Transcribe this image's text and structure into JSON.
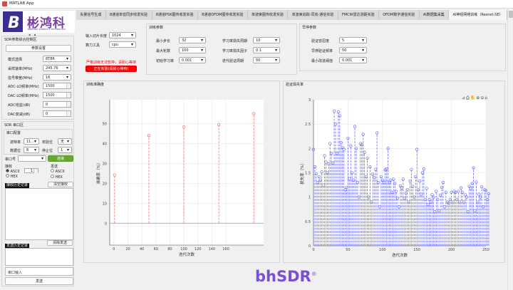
{
  "window": {
    "title": "MATLAB App"
  },
  "logo": {
    "company_cn": "彬鸿科技",
    "company_en": "BINHONG SCIENCE & TECHNOLOGY",
    "brand": "bhSDR",
    "registered": "®"
  },
  "sdr_params": {
    "title": "SDR参数综合控制区",
    "set_button": "参数设置",
    "rows": [
      {
        "label": "模式选择",
        "value": "8T8R",
        "type": "select"
      },
      {
        "label": "采样速率(MHz)",
        "value": "245.76",
        "type": "select"
      },
      {
        "label": "信号带宽(MHz)",
        "value": "16",
        "type": "select"
      },
      {
        "label": "ADC-LO频率(MHz)",
        "value": "1500",
        "type": "spin"
      },
      {
        "label": "DAC-LO频率(MHz)",
        "value": "1500",
        "type": "spin"
      },
      {
        "label": "ADC增益(dB)",
        "value": "0",
        "type": "spin"
      },
      {
        "label": "DAC衰减(dB)",
        "value": "0",
        "type": "spin"
      }
    ]
  },
  "serial": {
    "title": "SDR 串口区",
    "config_title": "串口配置",
    "baud_label": "波特率",
    "baud": "11...",
    "parity_label": "校验位",
    "parity": "无",
    "databits_label": "数据位",
    "databits": "8",
    "stopbits_label": "停止位",
    "stopbits": "1",
    "port_label": "串口号",
    "port": "",
    "connect": "连接",
    "recv_label": "接收",
    "send_label": "发送",
    "ascii": "ASCII",
    "hex": "HEX",
    "recv_spin": "1",
    "recv_history": "接收历史记录",
    "clear_recv": "清空接收",
    "send_history": "发送历史记录",
    "clear_send": "清除发送",
    "input_placeholder": "串口输入",
    "send_button": "发送"
  },
  "tabs": [
    {
      "label": "矢量信号生成",
      "active": false
    },
    {
      "label": "8通道单音同步收发实验",
      "active": false
    },
    {
      "label": "8通道PSK图传收发实验",
      "active": false
    },
    {
      "label": "8通道OFDM图传收发实验",
      "active": false
    },
    {
      "label": "单波束图传收发实验",
      "active": false
    },
    {
      "label": "单波束追踪-同向-通信实验",
      "active": false
    },
    {
      "label": "FMCW雷达测距实验",
      "active": false
    },
    {
      "label": "OFDM数字通信实验",
      "active": false
    },
    {
      "label": "AI数据集采集",
      "active": false
    },
    {
      "label": "AI神经网络训练（Resnet-SE）",
      "active": true
    }
  ],
  "main": {
    "slice_len_label": "输入切片长度",
    "slice_len": "1024",
    "compute_label": "算力工具",
    "compute": "cpu",
    "warning": "严格训练无法暂停，请耐心等待",
    "running_button": "正在实验(请耐心等待)",
    "train": {
      "title": "训练参数",
      "min_batch_label": "最小步长",
      "min_batch": "32",
      "max_epoch_label": "最大轮数",
      "max_epoch": "100",
      "init_lr_label": "初始学习率",
      "init_lr": "0.001",
      "lr_period_label": "学习率损失周期",
      "lr_period": "10",
      "lr_factor_label": "学习率损失因子",
      "lr_factor": "0.1",
      "val_freq_label": "迭代验证周期",
      "val_freq": "50"
    },
    "early": {
      "title": "早停参数",
      "patience_label": "验证容忍度",
      "patience": "5",
      "freq_label": "早停验证频率",
      "freq": "50",
      "min_delta_label": "最小改进阈值",
      "min_delta": "0.001"
    }
  },
  "chart_data": [
    {
      "type": "stem",
      "title": "训练准确度",
      "xlabel": "迭代次数",
      "ylabel": "准确率（%）",
      "color": "#ff7070",
      "xlim": [
        -6,
        214
      ],
      "ylim": [
        -11,
        62
      ],
      "xticks": [
        0,
        20,
        40,
        60,
        80,
        100,
        120,
        140,
        160
      ],
      "yticks": [
        0,
        10,
        20,
        30,
        40,
        50
      ],
      "grid": true,
      "x": [
        1,
        50,
        100,
        150,
        200
      ],
      "y": [
        24.2,
        44,
        48.3,
        49.5,
        55
      ]
    },
    {
      "type": "stem",
      "title": "验证损失率",
      "xlabel": "迭代次数",
      "ylabel": "损失率（%）",
      "color": "#6b6bff",
      "xlim": [
        0,
        250
      ],
      "ylim": [
        0,
        3
      ],
      "xticks": [
        0,
        50,
        100,
        150,
        200,
        250
      ],
      "yticks": [
        0,
        0.5,
        1,
        1.5,
        2,
        2.5,
        3
      ],
      "grid": true,
      "x_start": 0,
      "x_step": 2,
      "y": [
        1.98,
        1.62,
        1.48,
        1.3,
        1.42,
        1.35,
        1.52,
        1.25,
        1.85,
        1.72,
        1.5,
        1.68,
        2.1,
        1.9,
        1.7,
        2.77,
        2.5,
        1.9,
        2.75,
        2.67,
        2.12,
        2.02,
        1.98,
        1.15,
        1.2,
        2.21,
        1.38,
        2.05,
        1.5,
        1.35,
        2.45,
        2.0,
        1.3,
        1.0,
        2.1,
        2.08,
        2.29,
        1.92,
        1.42,
        1.8,
        1.0,
        1.62,
        0.9,
        1.47,
        1.4,
        1.57,
        2.32,
        1.3,
        0.8,
        1.42,
        1.35,
        1.3,
        1.56,
        1.58,
        2.0,
        1.3,
        1.35,
        1.1,
        1.37,
        1.28,
        1.12,
        0.98,
        0.8,
        1.23,
        1.19,
        1.37,
        0.98,
        1.08,
        1.15,
        0.9,
        1.33,
        1.57,
        1.22,
        1.0,
        1.42,
        1.98,
        1.15,
        1.33,
        1.06,
        1.5,
        1.58,
        0.95,
        1.18,
        0.85,
        0.95,
        0.9,
        1.05,
        1.0,
        0.7,
        1.12,
        0.95,
        0.72,
        1.04,
        1.2,
        1.3,
        0.8,
        1.1,
        0.9,
        0.88,
        0.95,
        1.1,
        0.9,
        1.12,
        1.1,
        0.95,
        1.12,
        0.9,
        1.19,
        1.1,
        0.9,
        1.05,
        1.0,
        0.7,
        1.22,
        1.18,
        1.28,
        1.6,
        0.72,
        1.31,
        0.9,
        1.06,
        1.0,
        1.21,
        0.8,
        1.15,
        1.14,
        0.95,
        1.07
      ]
    }
  ]
}
